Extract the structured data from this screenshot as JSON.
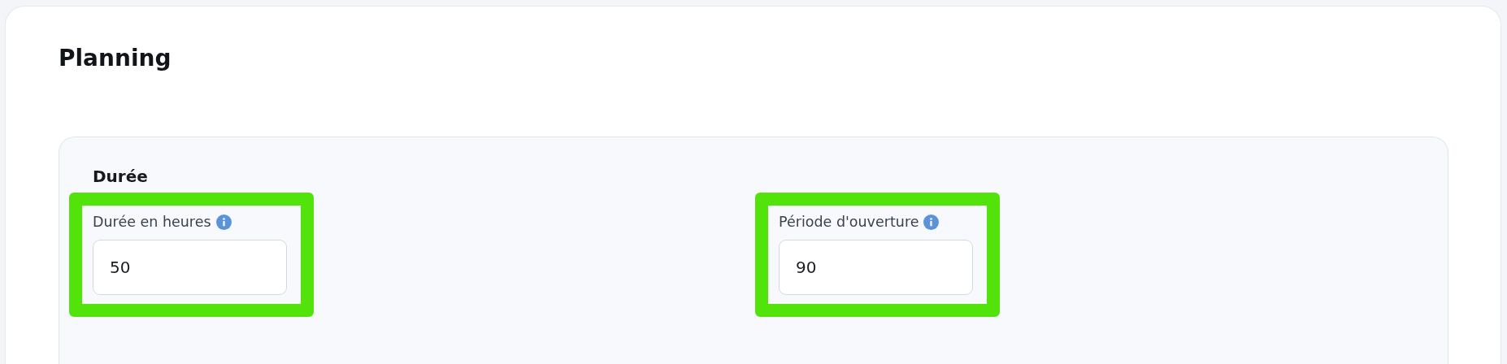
{
  "title": "Planning",
  "section": {
    "title": "Durée",
    "fields": [
      {
        "label": "Durée en heures",
        "value": "50",
        "highlighted": true
      },
      {
        "label": "Période d'ouverture",
        "value": "90",
        "highlighted": true
      }
    ]
  }
}
